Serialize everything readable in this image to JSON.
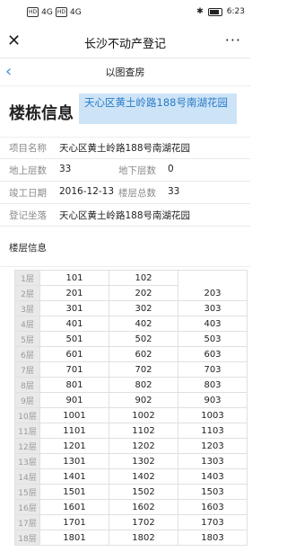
{
  "status_bar": {
    "left_icons": [
      "HD",
      "4G",
      "HD",
      "4G"
    ],
    "time": "6:23"
  },
  "titlebar": {
    "title": "长沙不动产登记"
  },
  "subnav": {
    "title": "以图查房"
  },
  "header": {
    "title": "楼栋信息",
    "address": "天心区黄土岭路188号南湖花园"
  },
  "info": {
    "project_label": "项目名称",
    "project_value": "天心区黄土岭路188号南湖花园",
    "above_label": "地上层数",
    "above_value": "33",
    "below_label": "地下层数",
    "below_value": "0",
    "completion_label": "竣工日期",
    "completion_value": "2016-12-13",
    "total_label": "楼层总数",
    "total_value": "33",
    "location_label": "登记坐落",
    "location_value": "天心区黄土岭路188号南湖花园"
  },
  "section": {
    "title": "楼层信息"
  },
  "floors": [
    {
      "floor": "1层",
      "units": [
        "101",
        "102",
        ""
      ]
    },
    {
      "floor": "2层",
      "units": [
        "201",
        "202",
        "203"
      ]
    },
    {
      "floor": "3层",
      "units": [
        "301",
        "302",
        "303"
      ]
    },
    {
      "floor": "4层",
      "units": [
        "401",
        "402",
        "403"
      ]
    },
    {
      "floor": "5层",
      "units": [
        "501",
        "502",
        "503"
      ]
    },
    {
      "floor": "6层",
      "units": [
        "601",
        "602",
        "603"
      ]
    },
    {
      "floor": "7层",
      "units": [
        "701",
        "702",
        "703"
      ]
    },
    {
      "floor": "8层",
      "units": [
        "801",
        "802",
        "803"
      ]
    },
    {
      "floor": "9层",
      "units": [
        "901",
        "902",
        "903"
      ]
    },
    {
      "floor": "10层",
      "units": [
        "1001",
        "1002",
        "1003"
      ]
    },
    {
      "floor": "11层",
      "units": [
        "1101",
        "1102",
        "1103"
      ]
    },
    {
      "floor": "12层",
      "units": [
        "1201",
        "1202",
        "1203"
      ]
    },
    {
      "floor": "13层",
      "units": [
        "1301",
        "1302",
        "1303"
      ]
    },
    {
      "floor": "14层",
      "units": [
        "1401",
        "1402",
        "1403"
      ]
    },
    {
      "floor": "15层",
      "units": [
        "1501",
        "1502",
        "1503"
      ]
    },
    {
      "floor": "16层",
      "units": [
        "1601",
        "1602",
        "1603"
      ]
    },
    {
      "floor": "17层",
      "units": [
        "1701",
        "1702",
        "1703"
      ]
    },
    {
      "floor": "18层",
      "units": [
        "1801",
        "1802",
        "1803"
      ]
    }
  ]
}
